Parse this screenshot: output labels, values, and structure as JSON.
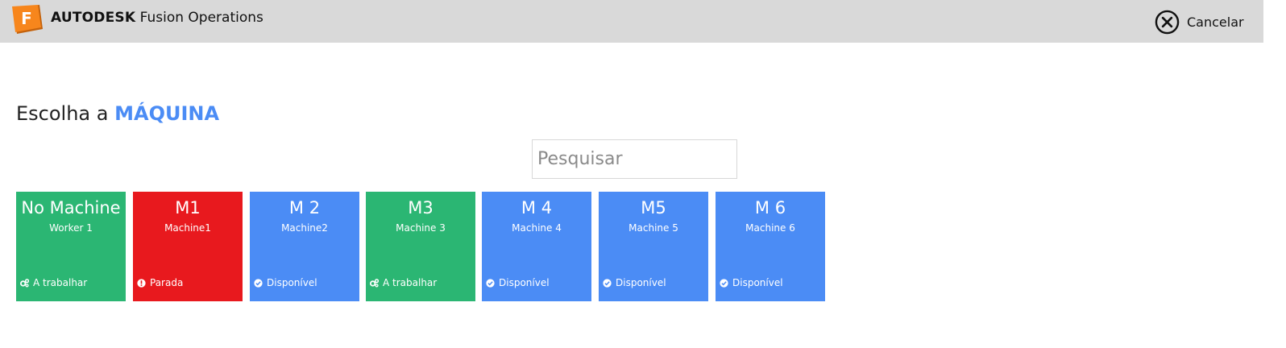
{
  "header": {
    "logo_letter": "F",
    "brand_bold": "AUTODESK",
    "brand_product": "Fusion Operations",
    "cancel_label": "Cancelar"
  },
  "heading": {
    "prefix": "Escolha a",
    "highlight": "MÁQUINA"
  },
  "search": {
    "placeholder": "Pesquisar",
    "value": ""
  },
  "colors": {
    "working": "#2bb673",
    "stopped": "#e8191e",
    "available": "#4b8cf5",
    "accent": "#4b8cf5",
    "topbar": "#d9d9d9",
    "logo": "#f7861c"
  },
  "machines": [
    {
      "name": "No Machine",
      "subtitle": "Worker 1",
      "status": "A trabalhar",
      "status_icon": "gears-icon",
      "state": "working"
    },
    {
      "name": "M1",
      "subtitle": "Machine1",
      "status": "Parada",
      "status_icon": "alert-icon",
      "state": "stopped"
    },
    {
      "name": "M 2",
      "subtitle": "Machine2",
      "status": "Disponível",
      "status_icon": "check-circle-icon",
      "state": "available"
    },
    {
      "name": "M3",
      "subtitle": "Machine 3",
      "status": "A trabalhar",
      "status_icon": "gears-icon",
      "state": "working"
    },
    {
      "name": "M 4",
      "subtitle": "Machine  4",
      "status": "Disponível",
      "status_icon": "check-circle-icon",
      "state": "available"
    },
    {
      "name": "M5",
      "subtitle": "Machine 5",
      "status": "Disponível",
      "status_icon": "check-circle-icon",
      "state": "available"
    },
    {
      "name": "M 6",
      "subtitle": "Machine 6",
      "status": "Disponível",
      "status_icon": "check-circle-icon",
      "state": "available"
    }
  ]
}
